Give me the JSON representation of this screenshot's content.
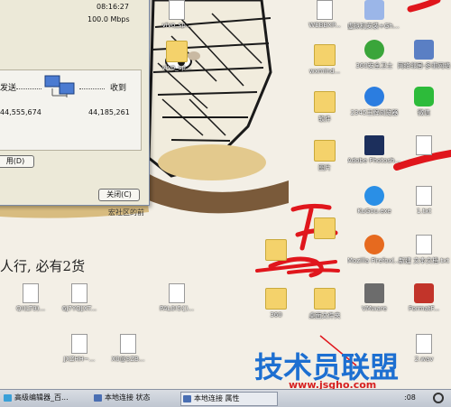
{
  "dialog": {
    "time_value": "08:16:27",
    "speed_value": "100.0 Mbps",
    "sent_label": "发送",
    "received_label": "收到",
    "sent_value": "44,555,674",
    "received_value": "44,185,261",
    "disable_button_partial": "用(D)",
    "close_button": "关闭(C)"
  },
  "desktop_partial_text": "宏社区的前",
  "wallpaper_text": "人行, 必有2货",
  "icons": {
    "webbxp": "WEBBXP...",
    "virtual_disk": "虚拟机安装+Ghost...",
    "vivo_sp_top": "vivo_sp...",
    "vivo_sp_mid": "vivo_sp...",
    "wxmind": "wxmind...",
    "sec_guard": "360安全卫士",
    "net_neighbor": "网络邻居-多重网络",
    "software": "软件",
    "ie_2345": "2345王牌浏览器",
    "wechat": "微信",
    "pictures": "图片",
    "photoshop": "Adobe Photoshop",
    "doc_icon": "",
    "kugou": "KuGou.exe",
    "txt_file": "1.txt",
    "folder_360": "360",
    "firefox": "Mozilla Firefox(火...",
    "new_txt": "新建 文本文档.txt",
    "png_1": "Q!(LT9)...",
    "png_2": "6J7YQ[XT...",
    "png_3": "PAL0!5{)...",
    "folder_360_b": "360",
    "desktop_folder": "桌面文件夹",
    "vmware": "VMware",
    "format_factory": "FormatF...",
    "png_4": "JXZHH~...",
    "png_5": "X0@$ZB...",
    "wav_file": "2.wav"
  },
  "taskbar": {
    "item1": "高级编辑器_百...",
    "item2": "本地连接 状态",
    "item3": "本地连接 属性",
    "clock": ":08"
  },
  "watermark": {
    "title": "技术员联盟",
    "url": "www.jsgho.com"
  },
  "colors": {
    "dialog_bg": "#ece9d8",
    "taskbar": "#c8ced8",
    "scribble_red": "#e0161c",
    "watermark_blue": "#1d6fd1"
  }
}
